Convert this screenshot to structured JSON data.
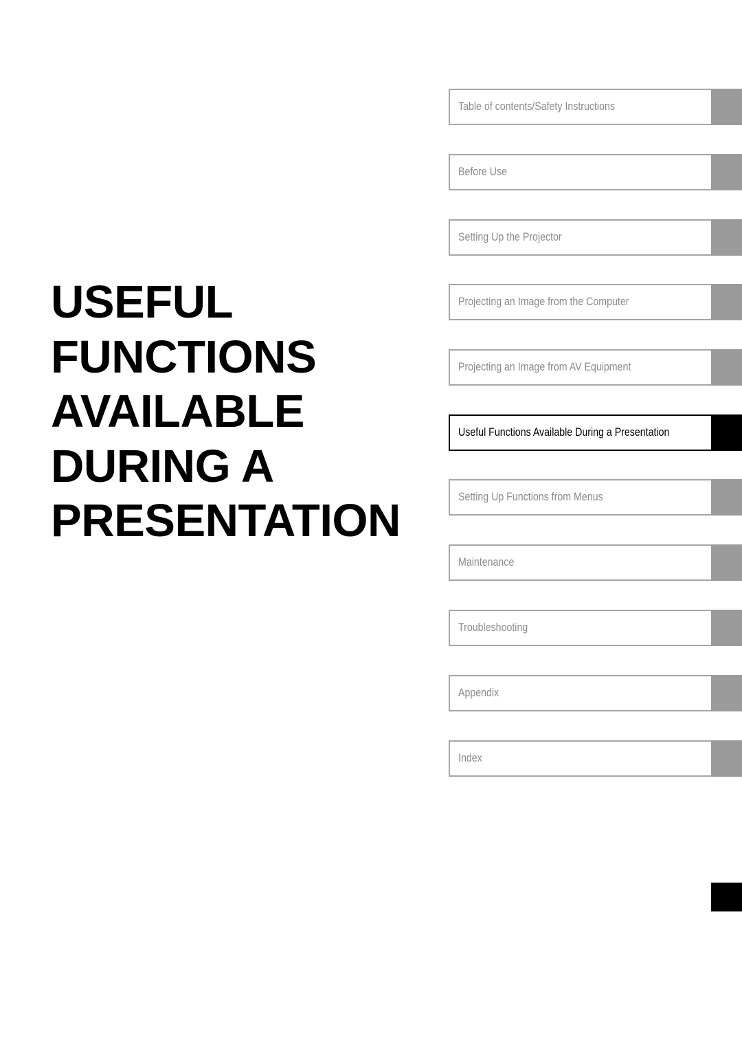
{
  "chapter": {
    "title_lines": [
      "USEFUL",
      "FUNCTIONS",
      "AVAILABLE",
      "DURING A",
      "PRESENTATION"
    ]
  },
  "chapter_tabs": [
    {
      "label": "Table of contents/Safety Instructions",
      "active": false
    },
    {
      "label": "Before Use",
      "active": false
    },
    {
      "label": "Setting Up the Projector",
      "active": false
    },
    {
      "label": "Projecting an Image from the Computer",
      "active": false
    },
    {
      "label": "Projecting an Image from AV Equipment",
      "active": false
    },
    {
      "label": "Useful Functions Available During a Presentation",
      "active": true
    },
    {
      "label": "Setting Up Functions from Menus",
      "active": false
    },
    {
      "label": "Maintenance",
      "active": false
    },
    {
      "label": "Troubleshooting",
      "active": false
    },
    {
      "label": "Appendix",
      "active": false
    },
    {
      "label": "Index",
      "active": false
    }
  ],
  "colors": {
    "active": "#000000",
    "inactive_marker": "#9b9b9b",
    "inactive_border": "#a6a6a6",
    "inactive_text": "#8a8a8a"
  }
}
